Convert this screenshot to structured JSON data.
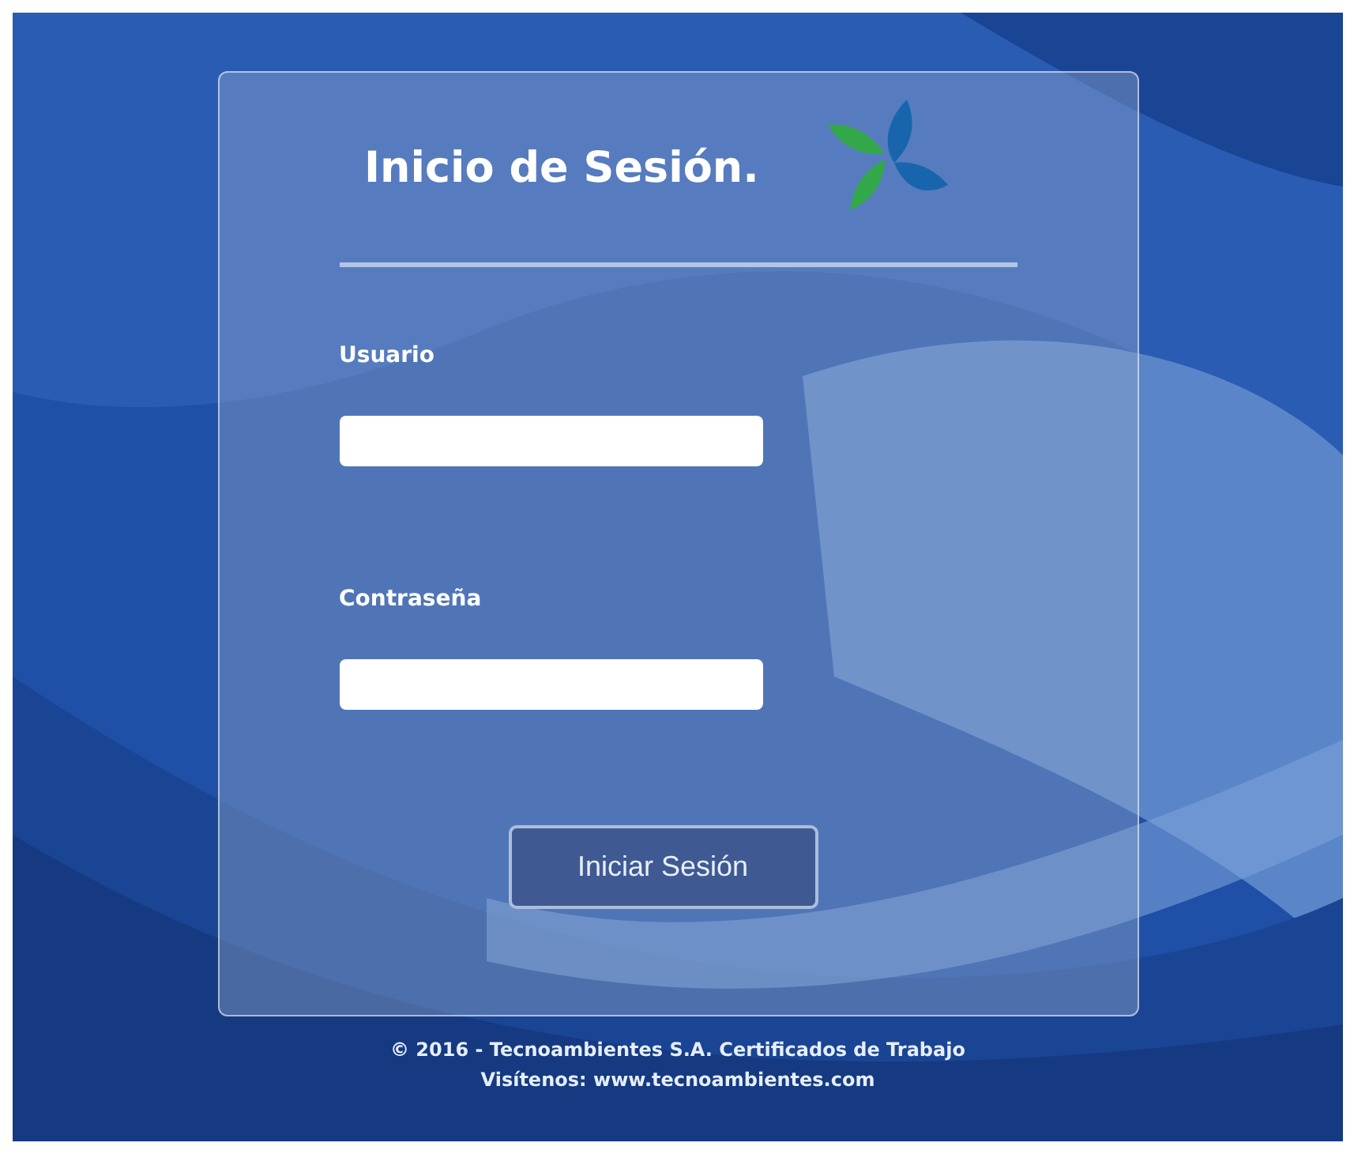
{
  "login": {
    "title": "Inicio de Sesión.",
    "fields": [
      {
        "label": "Usuario"
      },
      {
        "label": "Contraseña"
      }
    ],
    "button": "Iniciar Sesión"
  },
  "footer": {
    "copyright": "© 2016 - Tecnoambientes S.A. Certificados de Trabajo",
    "visit": "Visítenos: www.tecnoambientes.com"
  }
}
